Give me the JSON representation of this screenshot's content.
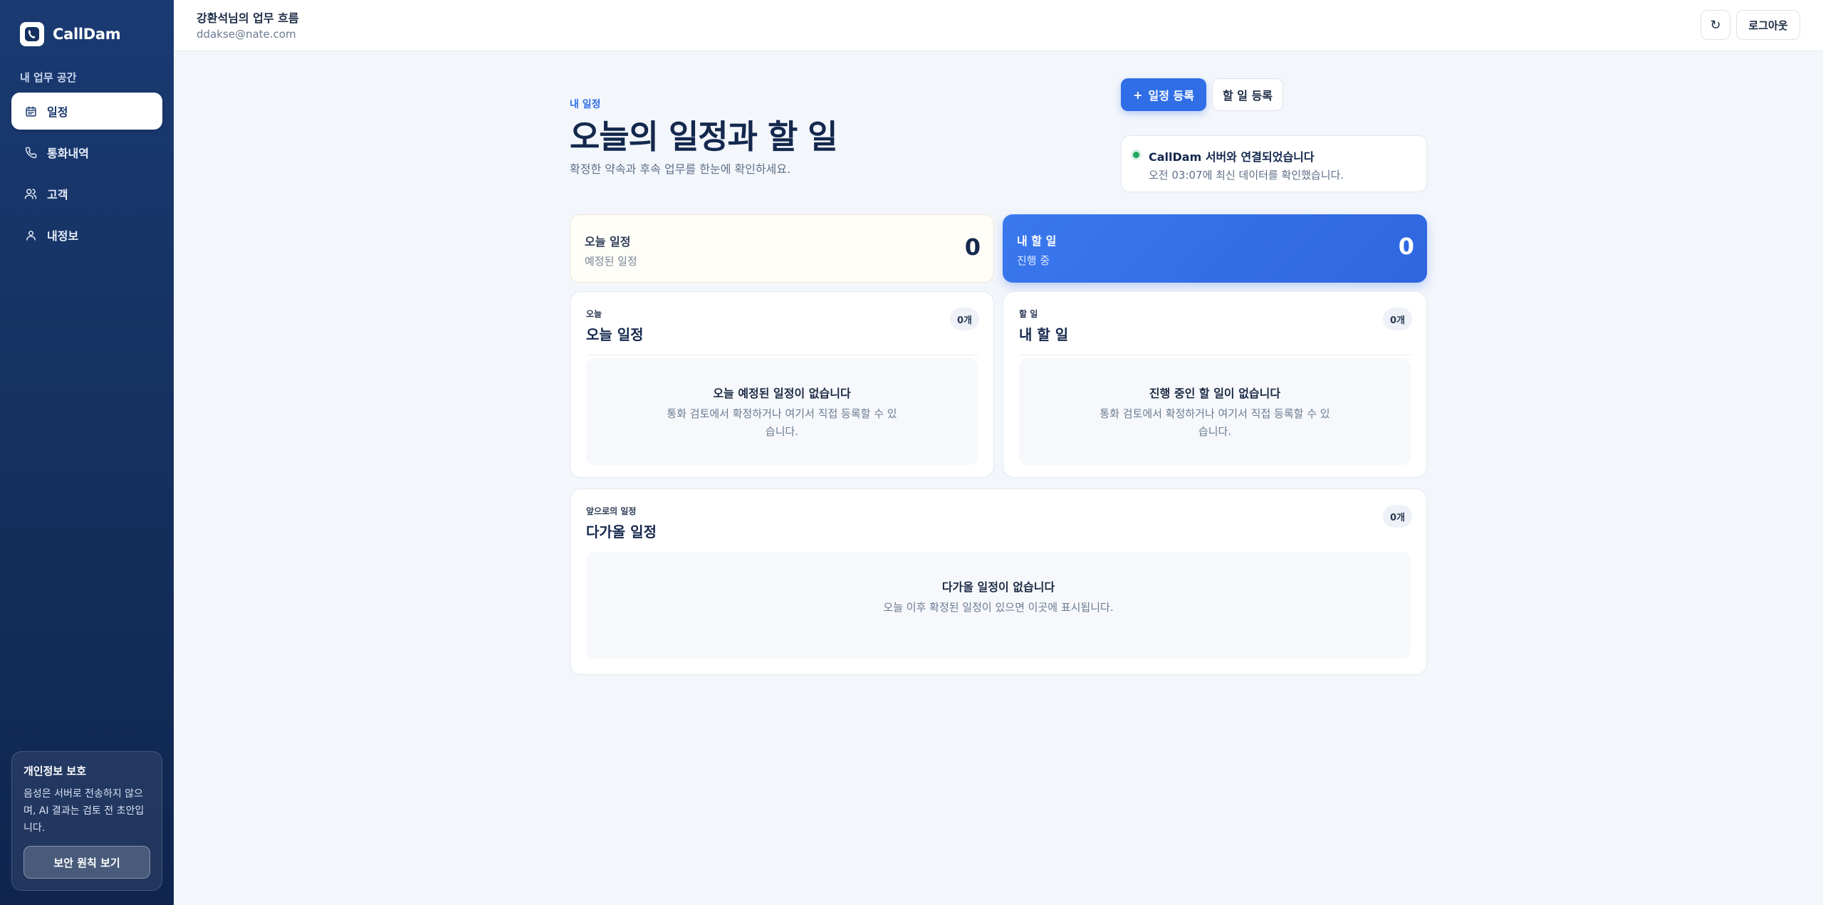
{
  "sidebar": {
    "logo_text": "CallDam",
    "section_title": "내 업무 공간",
    "items": [
      {
        "label": "일정",
        "icon": "calendar-icon",
        "active": true
      },
      {
        "label": "통화내역",
        "icon": "phone-icon",
        "active": false
      },
      {
        "label": "고객",
        "icon": "users-icon",
        "active": false
      },
      {
        "label": "내정보",
        "icon": "user-icon",
        "active": false
      }
    ],
    "privacy": {
      "title": "개인정보 보호",
      "text": "음성은 서버로 전송하지 않으며, AI 결과는 검토 전 초안입니다.",
      "button_label": "보안 원칙 보기"
    }
  },
  "header": {
    "user_title": "강환석님의 업무 흐름",
    "user_email": "ddakse@nate.com",
    "refresh_icon": "↻",
    "logout_label": "로그아웃"
  },
  "page": {
    "eyebrow": "내 일정",
    "title": "오늘의 일정과 할 일",
    "subtitle": "확정한 약속과 후속 업무를 한눈에 확인하세요.",
    "add_schedule_label": "일정 등록",
    "add_schedule_icon": "+",
    "add_todo_label": "할 일 등록"
  },
  "status": {
    "title": "CallDam 서버와 연결되었습니다",
    "text": "오전 03:07에 최신 데이터를 확인했습니다.",
    "color": "#1fa85f"
  },
  "summary": {
    "today": {
      "label": "오늘 일정",
      "sub": "예정된 일정",
      "count": "0"
    },
    "todo": {
      "label": "내 할 일",
      "sub": "진행 중",
      "count": "0"
    }
  },
  "panels": {
    "today": {
      "eyebrow": "오늘",
      "title": "오늘 일정",
      "badge": "0개",
      "empty_title": "오늘 예정된 일정이 없습니다",
      "empty_text": "통화 검토에서 확정하거나 여기서 직접 등록할 수 있습니다."
    },
    "todo": {
      "eyebrow": "할 일",
      "title": "내 할 일",
      "badge": "0개",
      "empty_title": "진행 중인 할 일이 없습니다",
      "empty_text": "통화 검토에서 확정하거나 여기서 직접 등록할 수 있습니다."
    },
    "upcoming": {
      "eyebrow": "앞으로의 일정",
      "title": "다가올 일정",
      "badge": "0개",
      "empty_title": "다가올 일정이 없습니다",
      "empty_text": "오늘 이후 확정된 일정이 있으면 이곳에 표시됩니다."
    }
  },
  "colors": {
    "accent": "#2f6ee6",
    "sidebar": "#15305f"
  }
}
